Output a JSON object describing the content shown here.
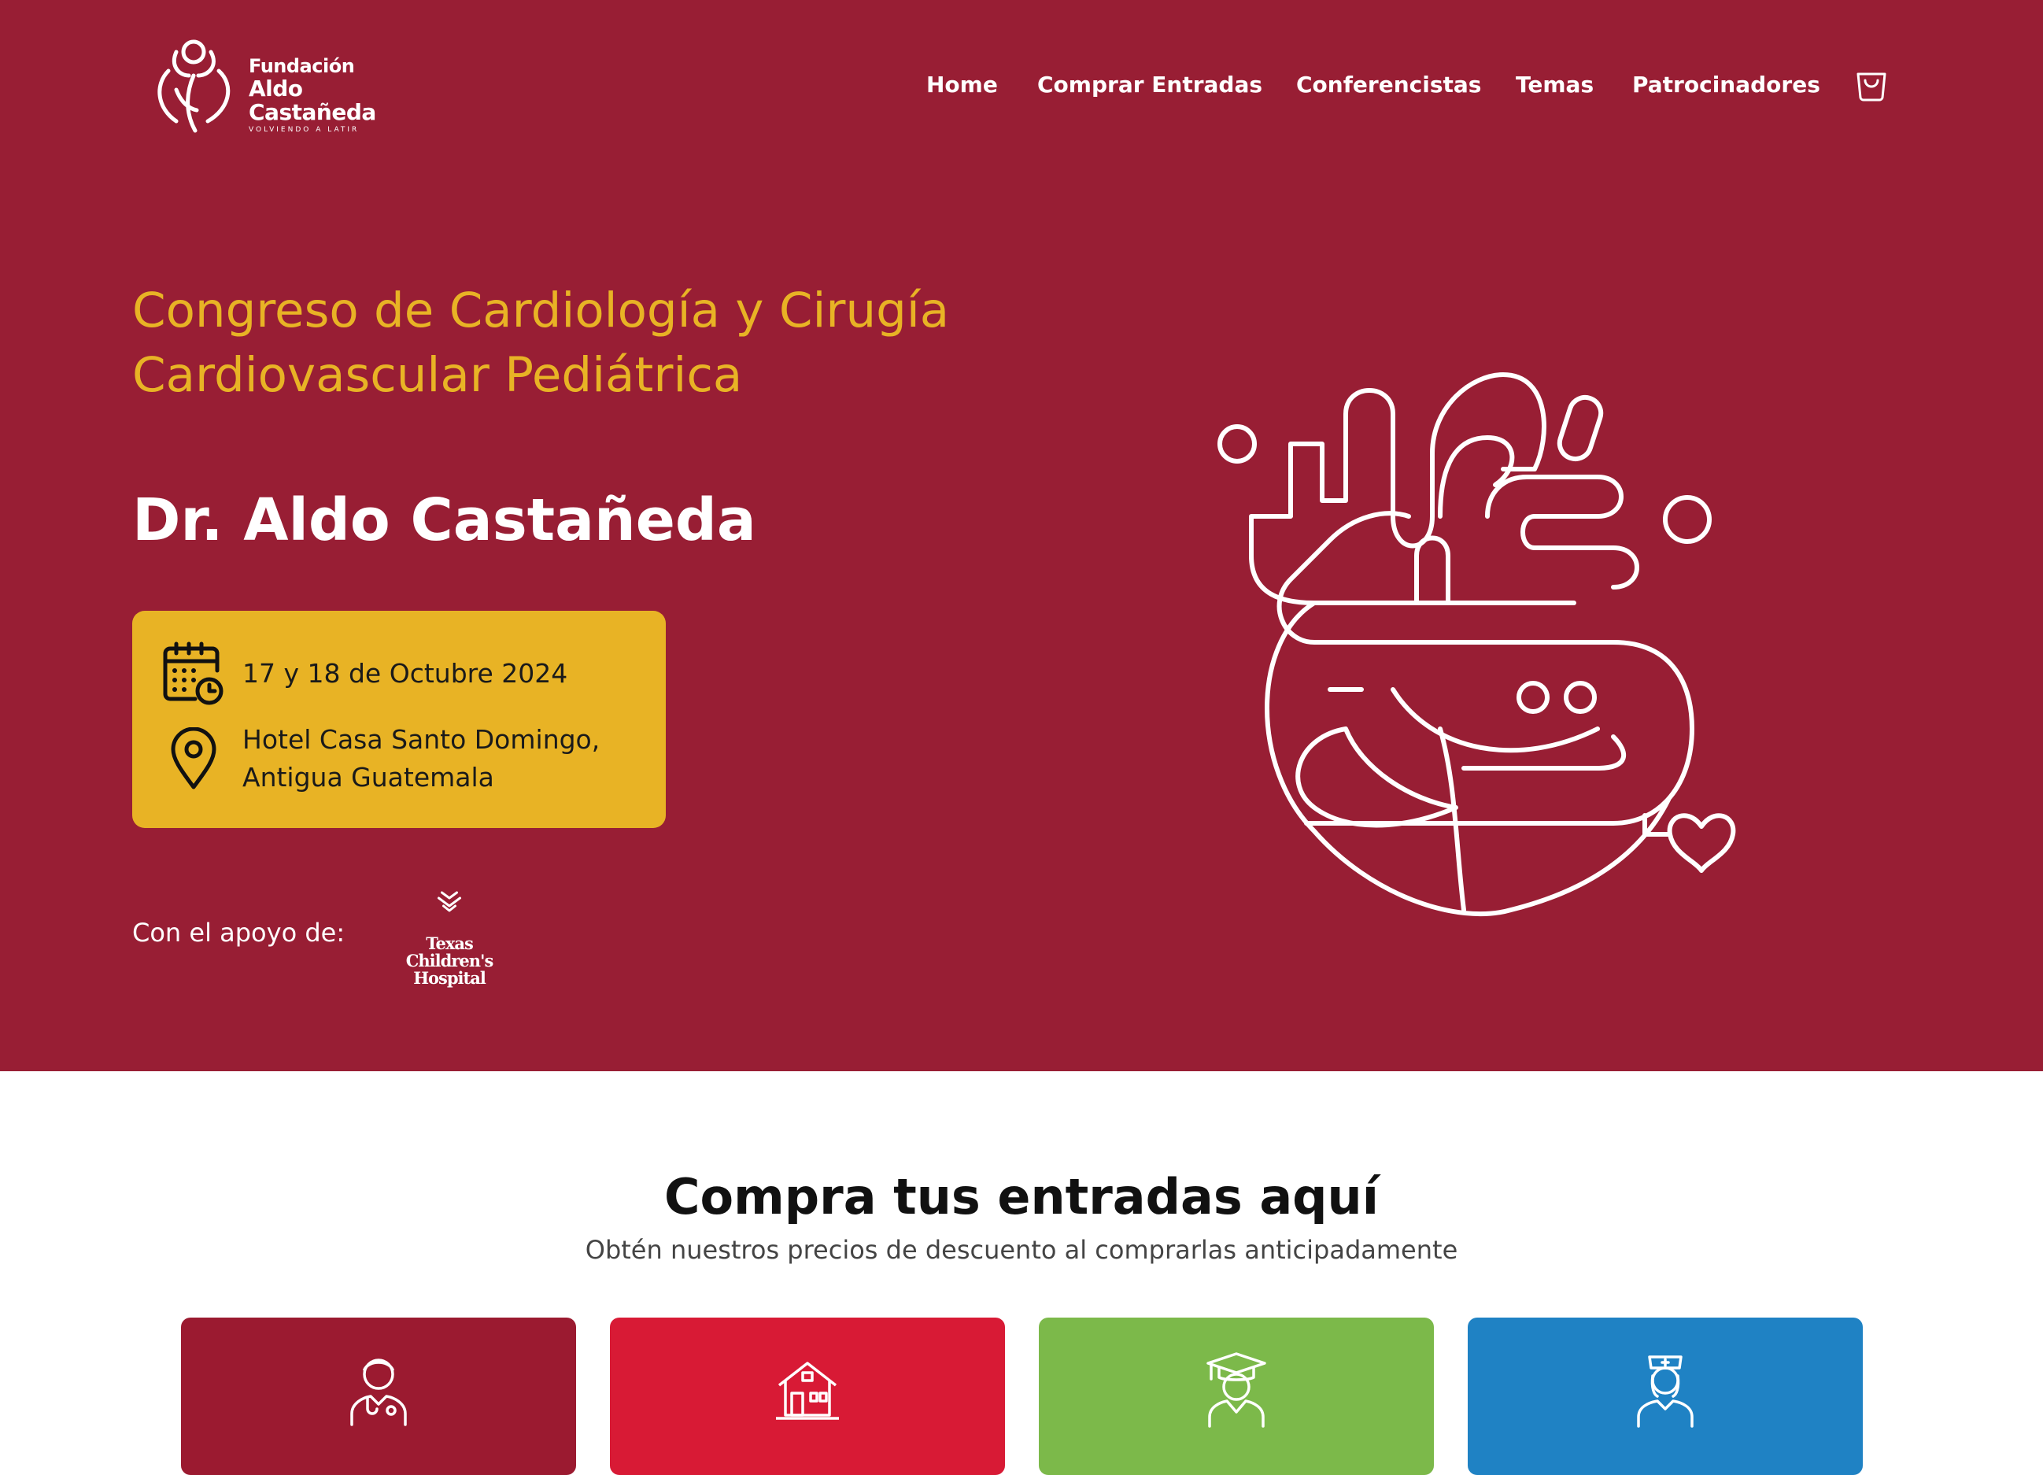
{
  "header": {
    "logo": {
      "line1": "Fundación",
      "line2": "Aldo Castañeda",
      "tagline": "VOLVIENDO A LATIR"
    },
    "nav": [
      "Home",
      "Comprar Entradas",
      "Conferencistas",
      "Temas",
      "Patrocinadores"
    ],
    "cart_icon": "shopping-bag-icon"
  },
  "hero": {
    "title": "Congreso de Cardiología y Cirugía Cardiovascular Pediátrica",
    "doctor_name": "Dr. Aldo Castañeda",
    "date": "17 y 18 de Octubre 2024",
    "venue_line1": "Hotel Casa Santo Domingo,",
    "venue_line2": "Antigua Guatemala",
    "support_label": "Con el apoyo de:",
    "sponsor_line1": "Texas Children's",
    "sponsor_line2": "Hospital",
    "icons": [
      "calendar-clock-icon",
      "location-pin-icon",
      "heart-illustration"
    ]
  },
  "tickets_section": {
    "title": "Compra tus entradas aquí",
    "subtitle": "Obtén nuestros precios de descuento al comprarlas anticipadamente",
    "cards": [
      {
        "icon": "doctor-icon",
        "color": "#9b1a30"
      },
      {
        "icon": "hospital-icon",
        "color": "#d81a35"
      },
      {
        "icon": "graduate-student-icon",
        "color": "#7cb94a"
      },
      {
        "icon": "nurse-icon",
        "color": "#1f82c4"
      }
    ]
  },
  "colors": {
    "brand": "#981e34",
    "accent": "#e8b325"
  }
}
